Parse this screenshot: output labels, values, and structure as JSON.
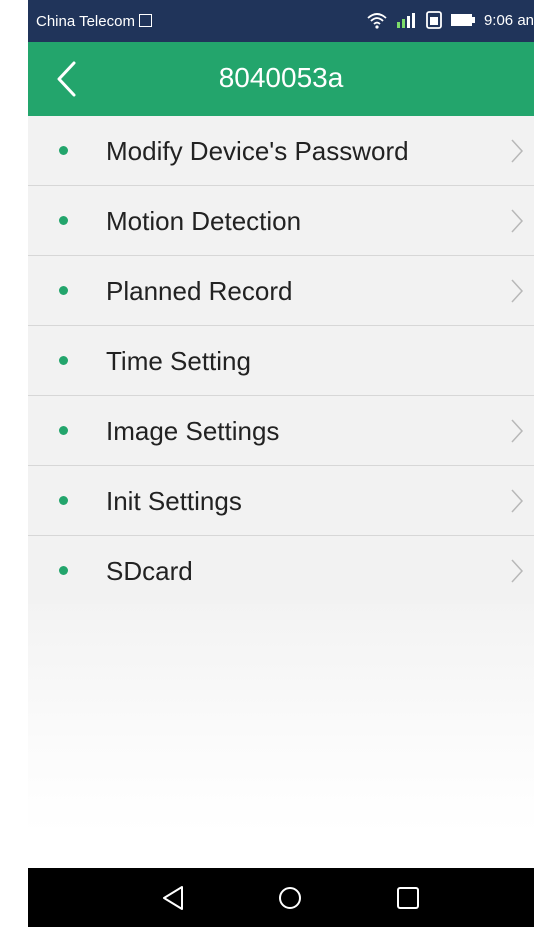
{
  "status_bar": {
    "carrier": "China Telecom",
    "time": "9:06 an"
  },
  "header": {
    "title": "8040053a"
  },
  "menu": {
    "items": [
      {
        "label": "Modify Device's Password",
        "has_chevron": true
      },
      {
        "label": "Motion Detection",
        "has_chevron": true
      },
      {
        "label": "Planned Record",
        "has_chevron": true
      },
      {
        "label": "Time Setting",
        "has_chevron": false
      },
      {
        "label": "Image Settings",
        "has_chevron": true
      },
      {
        "label": "Init Settings",
        "has_chevron": true
      },
      {
        "label": "SDcard",
        "has_chevron": true
      }
    ]
  },
  "icons": {
    "back": "chevron-left-icon",
    "item_arrow": "chevron-right-icon",
    "nav_back": "triangle-back-icon",
    "nav_home": "circle-home-icon",
    "nav_recents": "square-recents-icon"
  },
  "colors": {
    "accent": "#23a56c",
    "status_bar": "#20345a",
    "list_bg": "#f2f2f2",
    "divider": "#d7d7d7",
    "nav_bar": "#000000"
  }
}
